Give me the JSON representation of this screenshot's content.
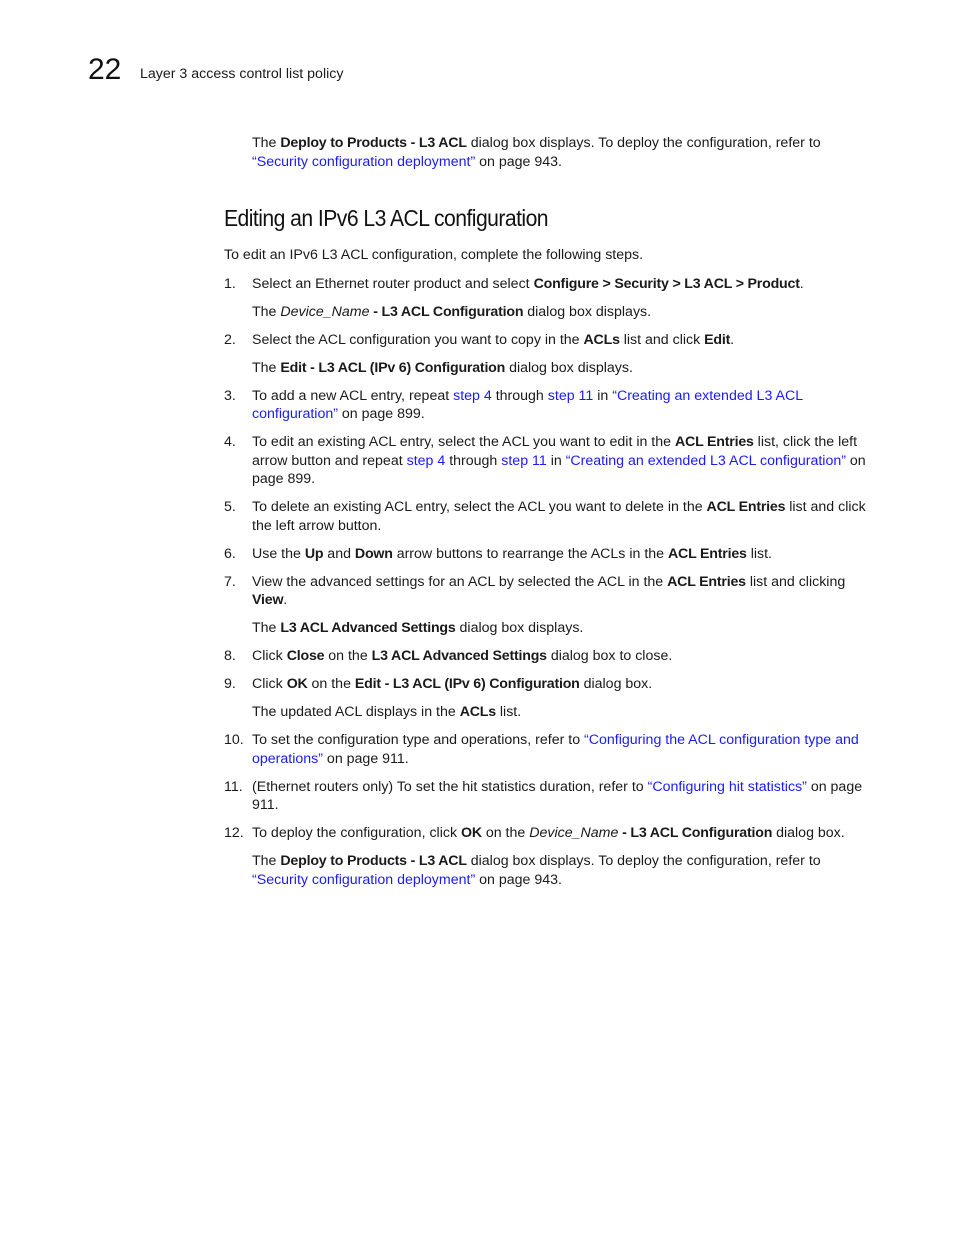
{
  "header": {
    "chapter_number": "22",
    "running_title": "Layer 3 access control list policy"
  },
  "top_paragraph": {
    "t1": "The ",
    "b1": "Deploy to Products - L3 ACL",
    "t2": " dialog box displays. To deploy the configuration, refer to ",
    "link": "“Security configuration deployment”",
    "t3": " on page 943."
  },
  "section": {
    "heading": "Editing an IPv6 L3 ACL configuration",
    "intro": "To edit an IPv6 L3 ACL configuration, complete the following steps."
  },
  "steps": {
    "s1": {
      "num": "1.",
      "t1": "Select an Ethernet router product and select ",
      "b1": "Configure > Security > L3 ACL > Product",
      "t2": ".",
      "sub": {
        "t1": "The ",
        "i1": "Device_Name",
        "b1": " - L3 ACL Configuration",
        "t2": " dialog box displays."
      }
    },
    "s2": {
      "num": "2.",
      "t1": "Select the ACL configuration you want to copy in the ",
      "b1": "ACLs",
      "t2": " list and click ",
      "b2": "Edit",
      "t3": ".",
      "sub": {
        "t1": "The ",
        "b1": "Edit - L3 ACL (IPv 6) Configuration",
        "t2": " dialog box displays."
      }
    },
    "s3": {
      "num": "3.",
      "t1": "To add a new ACL entry, repeat ",
      "l1": "step 4",
      "t2": " through ",
      "l2": "step 11",
      "t3": " in ",
      "l3": "“Creating an extended L3 ACL configuration”",
      "t4": " on page 899."
    },
    "s4": {
      "num": "4.",
      "t1": "To edit an existing ACL entry, select the ACL you want to edit in the ",
      "b1": "ACL Entries",
      "t2": " list, click the left arrow button and repeat ",
      "l1": "step 4",
      "t3": " through ",
      "l2": "step 11",
      "t4": " in ",
      "l3": "“Creating an extended L3 ACL configuration”",
      "t5": " on page 899."
    },
    "s5": {
      "num": "5.",
      "t1": "To delete an existing ACL entry, select the ACL you want to delete in the ",
      "b1": "ACL Entries",
      "t2": " list and click the left arrow button."
    },
    "s6": {
      "num": "6.",
      "t1": "Use the ",
      "b1": "Up",
      "t2": " and ",
      "b2": "Down",
      "t3": " arrow buttons to rearrange the ACLs in the ",
      "b3": "ACL Entries",
      "t4": " list."
    },
    "s7": {
      "num": "7.",
      "t1": "View the advanced settings for an ACL by selected the ACL in the ",
      "b1": "ACL Entries",
      "t2": " list and clicking ",
      "b2": "View",
      "t3": ".",
      "sub": {
        "t1": "The ",
        "b1": "L3 ACL Advanced Settings",
        "t2": " dialog box displays."
      }
    },
    "s8": {
      "num": "8.",
      "t1": "Click ",
      "b1": "Close",
      "t2": " on the ",
      "b2": "L3 ACL Advanced Settings",
      "t3": " dialog box to close."
    },
    "s9": {
      "num": "9.",
      "t1": "Click ",
      "b1": "OK",
      "t2": " on the ",
      "b2": "Edit - L3 ACL (IPv 6) Configuration",
      "t3": " dialog box.",
      "sub": {
        "t1": "The updated ACL displays in the ",
        "b1": "ACLs",
        "t2": " list."
      }
    },
    "s10": {
      "num": "10.",
      "t1": "To set the configuration type and operations, refer to ",
      "l1": "“Configuring the ACL configuration type and operations”",
      "t2": " on page 911."
    },
    "s11": {
      "num": "11.",
      "t1": "(Ethernet routers only) To set the hit statistics duration, refer to ",
      "l1": "“Configuring hit statistics”",
      "t2": " on page 911."
    },
    "s12": {
      "num": "12.",
      "t1": "To deploy the configuration, click ",
      "b1": "OK",
      "t2": " on the ",
      "i1": "Device_Name",
      "b2": " - L3 ACL Configuration",
      "t3": " dialog box.",
      "sub": {
        "t1": "The ",
        "b1": "Deploy to Products - L3 ACL",
        "t2": " dialog box displays. To deploy the configuration, refer to ",
        "l1": "“Security configuration deployment”",
        "t3": " on page 943."
      }
    }
  },
  "colors": {
    "link": "#1a1aff",
    "text": "#1a1a1a"
  }
}
